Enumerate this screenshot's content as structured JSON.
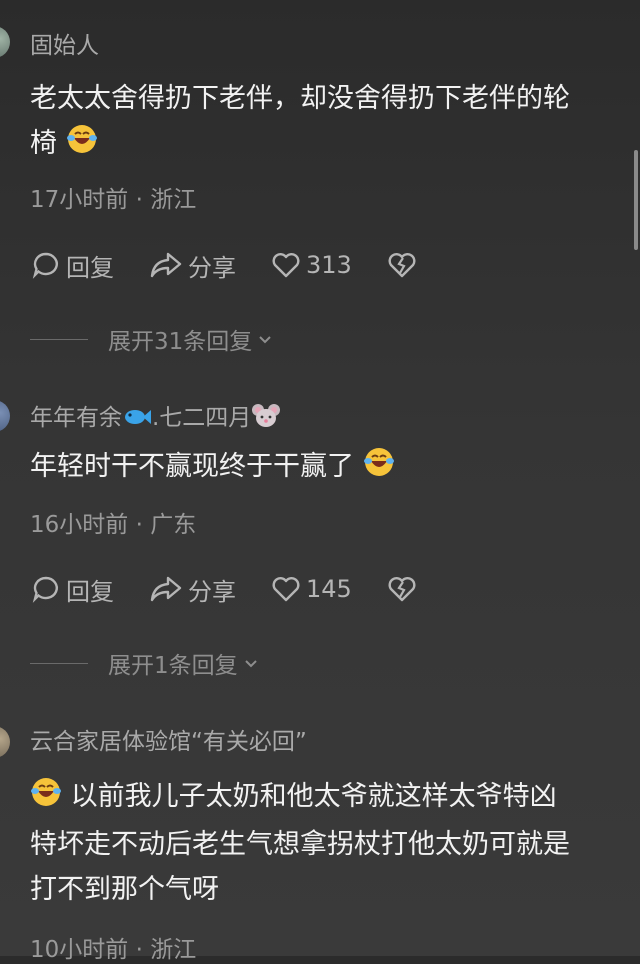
{
  "comments": [
    {
      "username": "固始人",
      "text_lines": [
        "老太太舍得扔下老伴，却没舍得扔下老伴的轮",
        "椅"
      ],
      "emoji": "laughing-tears-icon",
      "meta": "17小时前 · 浙江",
      "reply_label": "回复",
      "share_label": "分享",
      "likes": "313",
      "expand_label": "展开31条回复"
    },
    {
      "username": "年年有余",
      "username_suffix": ".七二四月",
      "username_icons": [
        "fish-icon",
        "mouse-icon"
      ],
      "text": "年轻时干不赢现终于干赢了",
      "emoji": "laughing-tears-icon",
      "meta": "16小时前 · 广东",
      "reply_label": "回复",
      "share_label": "分享",
      "likes": "145",
      "expand_label": "展开1条回复"
    },
    {
      "username": "云合家居体验馆“有关必回”",
      "text_lines": [
        "以前我儿子太奶和他太爷就这样太爷特凶",
        "特坏走不动后老生气想拿拐杖打他太奶可就是",
        "打不到那个气呀"
      ],
      "emoji": "laughing-tears-icon",
      "meta": "10小时前 · 浙江"
    }
  ],
  "colors": {
    "background": "#2f2f2f",
    "text": "#f2f2f2",
    "muted": "#9a9a9a"
  }
}
